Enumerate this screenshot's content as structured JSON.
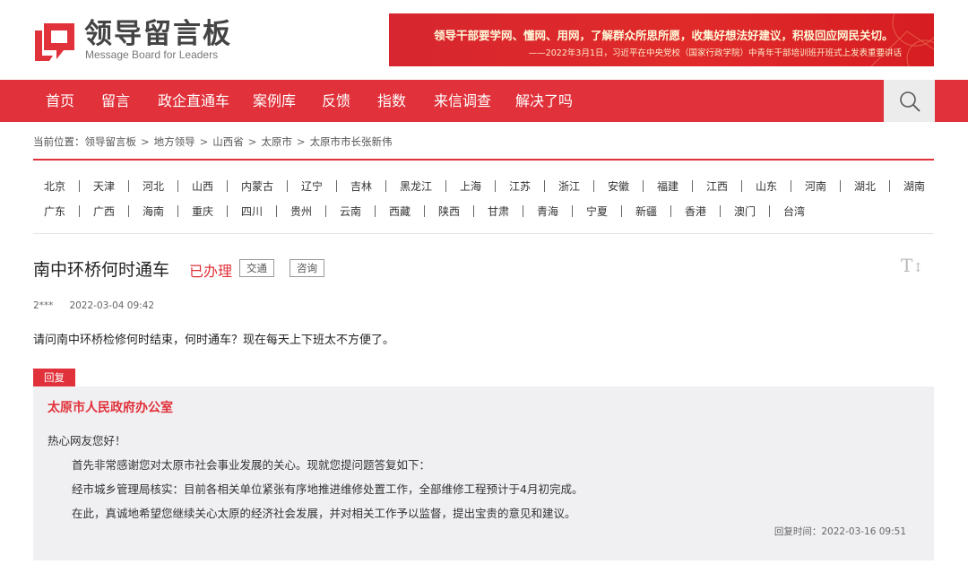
{
  "header": {
    "logo_cn": "领导留言板",
    "logo_en": "Message Board for Leaders",
    "banner_line1": "领导干部要学网、懂网、用网，了解群众所思所愿，收集好想法好建议，积极回应网民关切。",
    "banner_line2": "——2022年3月1日，习近平在中央党校（国家行政学院）中青年干部培训班开班式上发表重要讲话"
  },
  "nav": {
    "items": [
      "首页",
      "留言",
      "政企直通车",
      "案例库",
      "反馈",
      "指数",
      "来信调查",
      "解决了吗"
    ],
    "search_icon": "search-icon"
  },
  "breadcrumb": {
    "prefix": "当前位置：",
    "items": [
      "领导留言板",
      "地方领导",
      "山西省",
      "太原市",
      "太原市市长张新伟"
    ],
    "separator": ">"
  },
  "provinces": {
    "row1": [
      "北京",
      "天津",
      "河北",
      "山西",
      "内蒙古",
      "辽宁",
      "吉林",
      "黑龙江",
      "上海",
      "江苏",
      "浙江",
      "安徽",
      "福建",
      "江西",
      "山东",
      "河南",
      "湖北",
      "湖南"
    ],
    "row2": [
      "广东",
      "广西",
      "海南",
      "重庆",
      "四川",
      "贵州",
      "云南",
      "西藏",
      "陕西",
      "甘肃",
      "青海",
      "宁夏",
      "新疆",
      "香港",
      "澳门",
      "台湾"
    ]
  },
  "message": {
    "title": "南中环桥何时通车",
    "status": "已办理",
    "tags": [
      "交通",
      "咨询"
    ],
    "font_size_icon": "TI",
    "user": "2***",
    "time": "2022-03-04 09:42",
    "content": "请问南中环桥检修何时结束，何时通车？现在每天上下班太不方便了。"
  },
  "reply": {
    "tab_label": "回复",
    "org": "太原市人民政府办公室",
    "greeting": "热心网友您好！",
    "paragraphs": [
      "首先非常感谢您对太原市社会事业发展的关心。现就您提问题答复如下：",
      "经市城乡管理局核实：目前各相关单位紧张有序地推进维修处置工作，全部维修工程预计于4月初完成。",
      "在此，真诚地希望您继续关心太原的经济社会发展，并对相关工作予以监督，提出宝贵的意见和建议。"
    ],
    "time_label": "回复时间：",
    "time": "2022-03-16 09:51"
  },
  "colors": {
    "accent": "#e1313a",
    "reply_bg": "#f0f0f3"
  }
}
